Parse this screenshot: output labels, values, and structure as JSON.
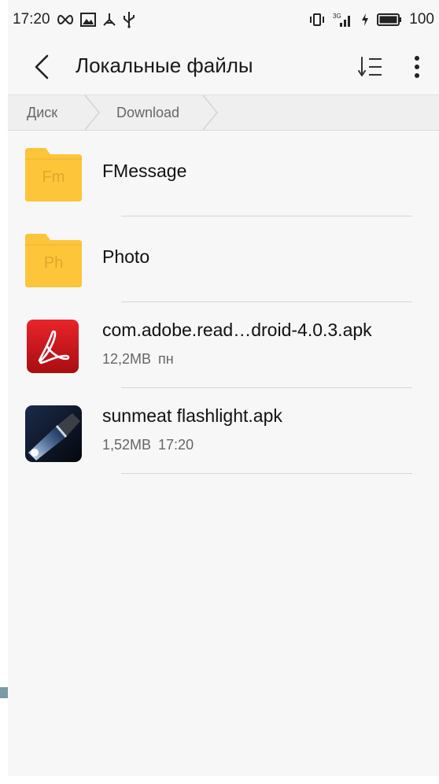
{
  "status_bar": {
    "time": "17:20",
    "battery_text": "100",
    "network_label": "3G",
    "icons_left": [
      "infinity-icon",
      "image-icon",
      "usb-debug-icon",
      "usb-icon"
    ],
    "icons_right": [
      "vibrate-icon",
      "signal-icon",
      "charging-icon",
      "battery-icon"
    ]
  },
  "app_bar": {
    "title": "Локальные файлы",
    "back_icon": "chevron-left-icon",
    "sort_icon": "sort-list-icon",
    "more_icon": "more-vertical-icon"
  },
  "breadcrumb": {
    "items": [
      "Диск",
      "Download"
    ]
  },
  "files": [
    {
      "name": "FMessage",
      "type": "folder",
      "icon_letters": "Fm",
      "meta": ""
    },
    {
      "name": "Photo",
      "type": "folder",
      "icon_letters": "Ph",
      "meta": ""
    },
    {
      "name": "com.adobe.read…droid-4.0.3.apk",
      "type": "apk",
      "icon": "adobe-reader-icon",
      "meta": "12,2MB пн"
    },
    {
      "name": "sunmeat flashlight.apk",
      "type": "apk",
      "icon": "flashlight-app-icon",
      "meta": "1,52MB 17:20"
    }
  ],
  "colors": {
    "folder": "#fcc53a",
    "folder_tab": "#f7b92c",
    "adobe_red": "#d4161a",
    "divider": "#d6d6d6",
    "background": "#f7f7f7"
  }
}
